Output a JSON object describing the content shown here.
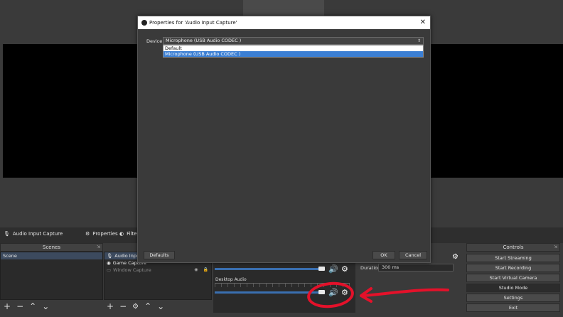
{
  "dialog": {
    "title": "Properties for 'Audio Input Capture'",
    "close_glyph": "✕",
    "device_label": "Device",
    "device_selected": "Microphone (USB Audio CODEC )",
    "device_options": [
      "Default",
      "Microphone (USB Audio CODEC )"
    ],
    "defaults_label": "Defaults",
    "ok_label": "OK",
    "cancel_label": "Cancel"
  },
  "toolbar": {
    "source_name": "Audio Input Capture",
    "properties_label": "Properties",
    "filters_label": "Filters"
  },
  "scenes": {
    "header": "Scenes",
    "items": [
      "Scene"
    ]
  },
  "sources": {
    "items": [
      "Audio Input",
      "Game Capture",
      "Window Capture"
    ]
  },
  "mixer": {
    "desktop_label": "Desktop Audio"
  },
  "transition": {
    "duration_label": "Duration",
    "duration_value": "300 ms"
  },
  "controls": {
    "header": "Controls",
    "buttons": [
      "Start Streaming",
      "Start Recording",
      "Start Virtual Camera",
      "Studio Mode",
      "Settings",
      "Exit"
    ]
  },
  "icons": {
    "mic": "microphone-icon",
    "gear": "gear-icon",
    "speaker": "speaker-icon",
    "filter": "filter-icon",
    "eye": "eye-icon",
    "lock": "lock-icon",
    "plus": "plus-icon",
    "minus": "minus-icon",
    "up": "arrow-up-icon",
    "down": "arrow-down-icon"
  },
  "colors": {
    "annotation_red": "#e4112a",
    "selection_blue": "#3b7fd4",
    "slider_blue": "#3a6fb0"
  }
}
